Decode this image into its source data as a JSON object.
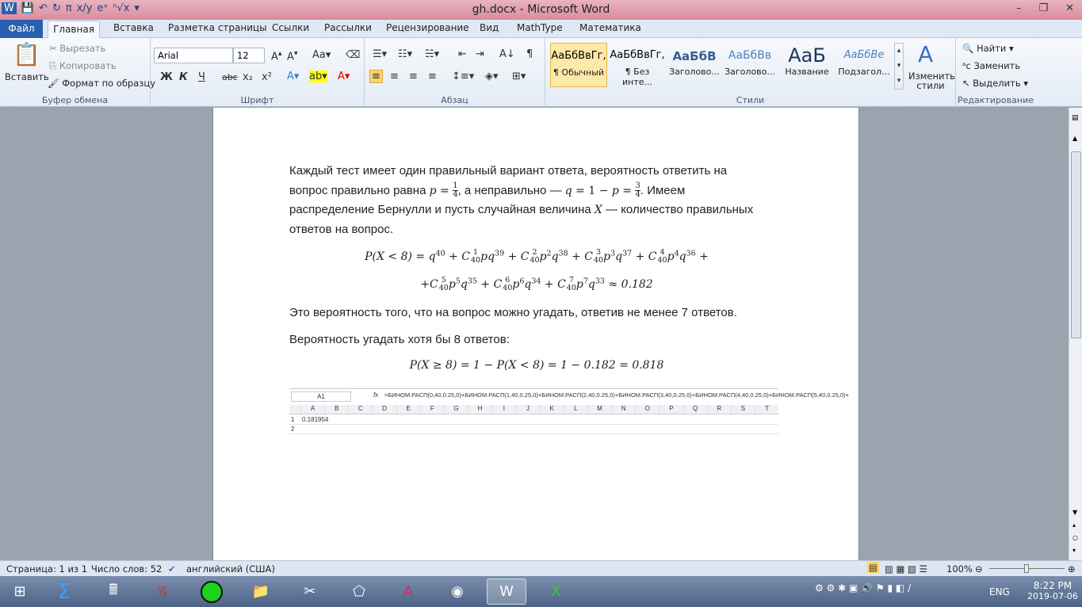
{
  "window": {
    "title": "gh.docx - Microsoft Word",
    "minimize": "–",
    "restore": "❐",
    "close": "✕"
  },
  "qat": [
    "W",
    "💾",
    "↶",
    "↻",
    "π",
    "x/y",
    "eˣ",
    "ⁿ√x",
    "▾"
  ],
  "tabs": [
    "Файл",
    "Главная",
    "Вставка",
    "Разметка страницы",
    "Ссылки",
    "Рассылки",
    "Рецензирование",
    "Вид",
    "MathType",
    "Математика"
  ],
  "ribbon": {
    "clipboard": {
      "label": "Буфер обмена",
      "paste": "Вставить",
      "cut": "Вырезать",
      "copy": "Копировать",
      "format": "Формат по образцу"
    },
    "font": {
      "label": "Шрифт",
      "name": "Arial",
      "size": "12",
      "bold": "Ж",
      "italic": "К",
      "underline": "Ч",
      "strike": "abc",
      "sub": "x₂",
      "sup": "x²"
    },
    "paragraph": {
      "label": "Абзац"
    },
    "styles": {
      "label": "Стили",
      "items": [
        {
          "preview": "АаБбВвГг,",
          "name": "¶ Обычный"
        },
        {
          "preview": "АаБбВвГг,",
          "name": "¶ Без инте..."
        },
        {
          "preview": "АаБбВ",
          "name": "Заголово..."
        },
        {
          "preview": "АаБбВв",
          "name": "Заголово..."
        },
        {
          "preview": "АаБ",
          "name": "Название"
        },
        {
          "preview": "АаБбВе",
          "name": "Подзагол..."
        }
      ],
      "change": "Изменить стили"
    },
    "editing": {
      "label": "Редактирование",
      "find": "Найти",
      "replace": "Заменить",
      "select": "Выделить"
    }
  },
  "document": {
    "intro": [
      {
        "t": "Каждый тест имеет один правильный  вариант ответа, вероятность ответить на вопрос правильно равна "
      },
      {
        "m": "p"
      },
      {
        "mn": " = "
      },
      {
        "frac": [
          "1",
          "4"
        ]
      },
      {
        "t": ", а неправильно — "
      },
      {
        "m": "q"
      },
      {
        "mn": " = 1 − "
      },
      {
        "m": "p"
      },
      {
        "mn": " = "
      },
      {
        "frac": [
          "3",
          "4"
        ]
      },
      {
        "t": ". Имеем распределение Бернулли и пусть случайная величина "
      },
      {
        "m": "X"
      },
      {
        "t": " — количество правильных ответов на вопрос."
      }
    ],
    "formula1": [
      {
        "x": "P(X < 8) = q"
      },
      {
        "sup": "40"
      },
      {
        "x": " + C"
      },
      {
        "sup": "1",
        "sub": "40"
      },
      {
        "x": "pq"
      },
      {
        "sup": "39"
      },
      {
        "x": " + C"
      },
      {
        "sup": "2",
        "sub": "40"
      },
      {
        "x": "p"
      },
      {
        "sup": "2"
      },
      {
        "x": "q"
      },
      {
        "sup": "38"
      },
      {
        "x": " + C"
      },
      {
        "sup": "3",
        "sub": "40"
      },
      {
        "x": "p"
      },
      {
        "sup": "3"
      },
      {
        "x": "q"
      },
      {
        "sup": "37"
      },
      {
        "x": " + C"
      },
      {
        "sup": "4",
        "sub": "40"
      },
      {
        "x": "p"
      },
      {
        "sup": "4"
      },
      {
        "x": "q"
      },
      {
        "sup": "36"
      },
      {
        "x": " +"
      }
    ],
    "formula2": [
      {
        "x": "+C"
      },
      {
        "sup": "5",
        "sub": "40"
      },
      {
        "x": "p"
      },
      {
        "sup": "5"
      },
      {
        "x": "q"
      },
      {
        "sup": "35"
      },
      {
        "x": " + C"
      },
      {
        "sup": "6",
        "sub": "40"
      },
      {
        "x": "p"
      },
      {
        "sup": "6"
      },
      {
        "x": "q"
      },
      {
        "sup": "34"
      },
      {
        "x": " + C"
      },
      {
        "sup": "7",
        "sub": "40"
      },
      {
        "x": "p"
      },
      {
        "sup": "7"
      },
      {
        "x": "q"
      },
      {
        "sup": "33"
      },
      {
        "x": " ≈ 0.182"
      }
    ],
    "line2": "Это вероятность того, что на вопрос можно угадать, ответив не менее 7 ответов.",
    "line3": "Вероятность угадать хотя бы 8 ответов:",
    "formula3": "P(X ≥ 8) = 1 − P(X < 8) = 1 − 0.182 = 0.818",
    "excel": {
      "cell_ref": "A1",
      "fx": "fx",
      "formula": "=БИНОМ.РАСП(0,40,0.25,0)+БИНОМ.РАСП(1,40,0.25,0)+БИНОМ.РАСП(2,40,0.25,0)+БИНОМ.РАСП(3,40,0.25,0)+БИНОМ.РАСП(4,40,0.25,0)+БИНОМ.РАСП(5,40,0.25,0)+",
      "columns": [
        "A",
        "B",
        "C",
        "D",
        "E",
        "F",
        "G",
        "H",
        "I",
        "J",
        "K",
        "L",
        "M",
        "N",
        "O",
        "P",
        "Q",
        "R",
        "S",
        "T"
      ],
      "rows": [
        "1",
        "2"
      ],
      "a1": "0.181954"
    }
  },
  "status": {
    "page": "Страница: 1 из 1",
    "words": "Число слов: 52",
    "lang": "английский (США)",
    "zoom": "100%"
  },
  "taskbar": {
    "lang": "ENG",
    "time": "8:22 PM",
    "date": "2019-07-06",
    "apps": [
      "Start",
      "MathCAD",
      "Calculator",
      "Graph",
      "Green circle",
      "Explorer",
      "Snipping",
      "GeoGebra",
      "Acrobat",
      "Chrome",
      "Word",
      "Excel"
    ]
  }
}
